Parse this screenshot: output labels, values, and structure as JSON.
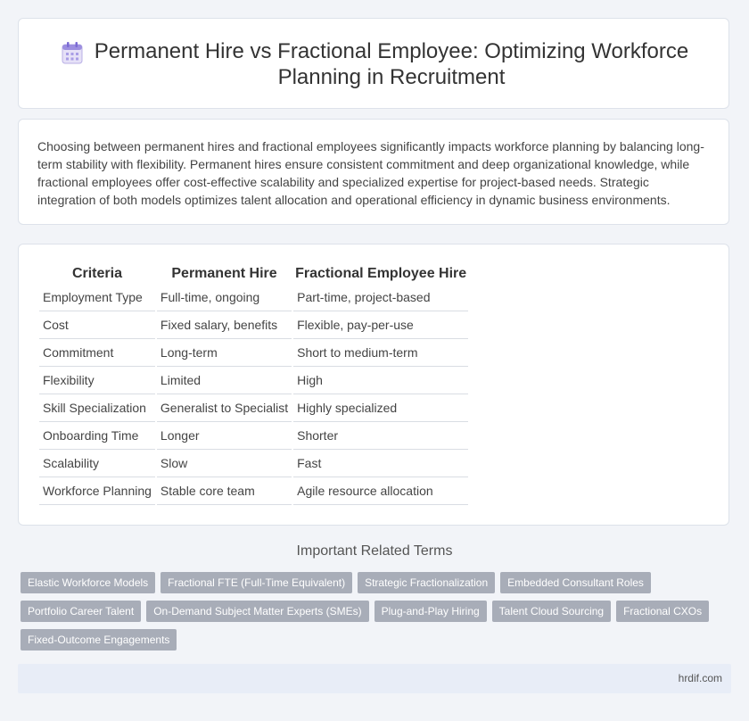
{
  "header": {
    "title": "Permanent Hire vs Fractional Employee: Optimizing Workforce Planning in Recruitment",
    "icon": "calendar-icon"
  },
  "intro": {
    "text": "Choosing between permanent hires and fractional employees significantly impacts workforce planning by balancing long-term stability with flexibility. Permanent hires ensure consistent commitment and deep organizational knowledge, while fractional employees offer cost-effective scalability and specialized expertise for project-based needs. Strategic integration of both models optimizes talent allocation and operational efficiency in dynamic business environments."
  },
  "table": {
    "headers": [
      "Criteria",
      "Permanent Hire",
      "Fractional Employee Hire"
    ],
    "rows": [
      [
        "Employment Type",
        "Full-time, ongoing",
        "Part-time, project-based"
      ],
      [
        "Cost",
        "Fixed salary, benefits",
        "Flexible, pay-per-use"
      ],
      [
        "Commitment",
        "Long-term",
        "Short to medium-term"
      ],
      [
        "Flexibility",
        "Limited",
        "High"
      ],
      [
        "Skill Specialization",
        "Generalist to Specialist",
        "Highly specialized"
      ],
      [
        "Onboarding Time",
        "Longer",
        "Shorter"
      ],
      [
        "Scalability",
        "Slow",
        "Fast"
      ],
      [
        "Workforce Planning",
        "Stable core team",
        "Agile resource allocation"
      ]
    ]
  },
  "related": {
    "title": "Important Related Terms",
    "tags": [
      "Elastic Workforce Models",
      "Fractional FTE (Full-Time Equivalent)",
      "Strategic Fractionalization",
      "Embedded Consultant Roles",
      "Portfolio Career Talent",
      "On-Demand Subject Matter Experts (SMEs)",
      "Plug-and-Play Hiring",
      "Talent Cloud Sourcing",
      "Fractional CXOs",
      "Fixed-Outcome Engagements"
    ]
  },
  "footer": {
    "site": "hrdif.com"
  }
}
